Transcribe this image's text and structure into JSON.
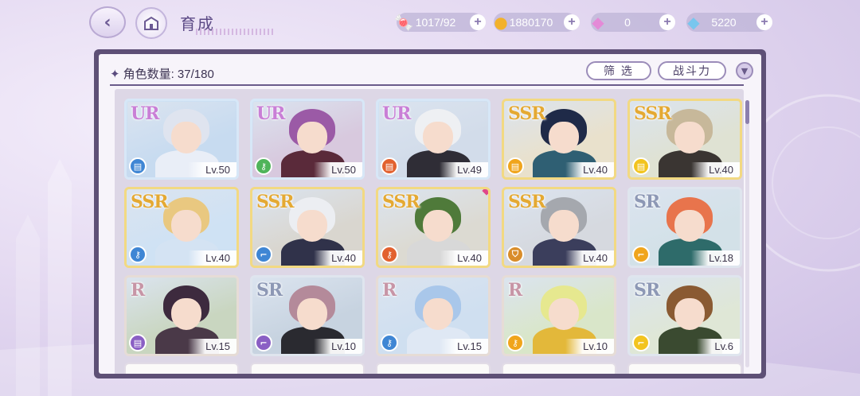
{
  "header": {
    "title": "育成",
    "back_icon": "back-arrow-icon",
    "home_icon": "castle-icon"
  },
  "resources": [
    {
      "name": "candy",
      "icon": "candy-icon",
      "value": "1017/92",
      "color": "#e8588a"
    },
    {
      "name": "gold",
      "icon": "coin-icon",
      "value": "1880170",
      "color": "#f2b12b"
    },
    {
      "name": "pink-diamond",
      "icon": "pink-diamond-icon",
      "value": "0",
      "color": "#e48ad7"
    },
    {
      "name": "diamond",
      "icon": "diamond-icon",
      "value": "5220",
      "color": "#78c6ee"
    }
  ],
  "panel": {
    "count_label": "角色数量:",
    "count_value": "37/180",
    "filter_label": "筛 选",
    "sort_label": "战斗力"
  },
  "characters": [
    {
      "rarity": "UR",
      "level": "Lv.50",
      "elem_color": "#3f86d4",
      "elem_icon": "scroll-icon",
      "hair": "#dfe4ef",
      "outfit": "#e9eef7",
      "bg": "#c7dbf0"
    },
    {
      "rarity": "UR",
      "level": "Lv.50",
      "elem_color": "#4fb45a",
      "elem_icon": "key-icon",
      "hair": "#9b5aa6",
      "outfit": "#5a2a3a",
      "bg": "#d8c9de"
    },
    {
      "rarity": "UR",
      "level": "Lv.49",
      "elem_color": "#e2612f",
      "elem_icon": "scroll-icon",
      "hair": "#eef0f3",
      "outfit": "#2f2d36",
      "bg": "#d2dcea"
    },
    {
      "rarity": "SSR",
      "level": "Lv.40",
      "elem_color": "#f0a51c",
      "elem_icon": "scroll-icon",
      "hair": "#1f2a48",
      "outfit": "#2f5f73",
      "bg": "#e9e1cc"
    },
    {
      "rarity": "SSR",
      "level": "Lv.40",
      "elem_color": "#f2c41f",
      "elem_icon": "scroll-icon",
      "hair": "#c7b89a",
      "outfit": "#3a3532",
      "bg": "#dfe2d3"
    },
    {
      "rarity": "SSR",
      "level": "Lv.40",
      "elem_color": "#3f86d4",
      "elem_icon": "key-icon",
      "hair": "#e9c880",
      "outfit": "#d4e3f3",
      "bg": "#cfe2f4"
    },
    {
      "rarity": "SSR",
      "level": "Lv.40",
      "elem_color": "#3f86d4",
      "elem_icon": "boot-icon",
      "hair": "#eceef2",
      "outfit": "#30324a",
      "bg": "#d9d6cf"
    },
    {
      "rarity": "SSR",
      "level": "Lv.40",
      "elem_color": "#e2612f",
      "elem_icon": "key-icon",
      "hair": "#4f7a3a",
      "outfit": "#d8d8d8",
      "bg": "#dcdad2"
    },
    {
      "rarity": "SSR",
      "level": "Lv.40",
      "elem_color": "#d98d2a",
      "elem_icon": "shield-icon",
      "hair": "#a5a8ae",
      "outfit": "#3b3e5c",
      "bg": "#d6d9df"
    },
    {
      "rarity": "SR",
      "level": "Lv.18",
      "elem_color": "#f0a51c",
      "elem_icon": "boot-icon",
      "hair": "#e8744c",
      "outfit": "#2e6b6a",
      "bg": "#d3e1e8"
    },
    {
      "rarity": "R",
      "level": "Lv.15",
      "elem_color": "#8a5fc4",
      "elem_icon": "scroll-icon",
      "hair": "#3d2a3e",
      "outfit": "#4a3948",
      "bg": "#c9d6c0"
    },
    {
      "rarity": "SR",
      "level": "Lv.10",
      "elem_color": "#8a5fc4",
      "elem_icon": "boot-icon",
      "hair": "#b48a9a",
      "outfit": "#2a2a30",
      "bg": "#c7d3e0"
    },
    {
      "rarity": "R",
      "level": "Lv.15",
      "elem_color": "#3f86d4",
      "elem_icon": "key-icon",
      "hair": "#a9c7ea",
      "outfit": "#dfe8f4",
      "bg": "#cfdff0"
    },
    {
      "rarity": "R",
      "level": "Lv.10",
      "elem_color": "#f0a51c",
      "elem_icon": "key-icon",
      "hair": "#e6e88f",
      "outfit": "#e3b83a",
      "bg": "#d9e6c9"
    },
    {
      "rarity": "SR",
      "level": "Lv.6",
      "elem_color": "#f2c41f",
      "elem_icon": "boot-icon",
      "hair": "#8a5a32",
      "outfit": "#3a4a30",
      "bg": "#dfe7d6"
    }
  ]
}
